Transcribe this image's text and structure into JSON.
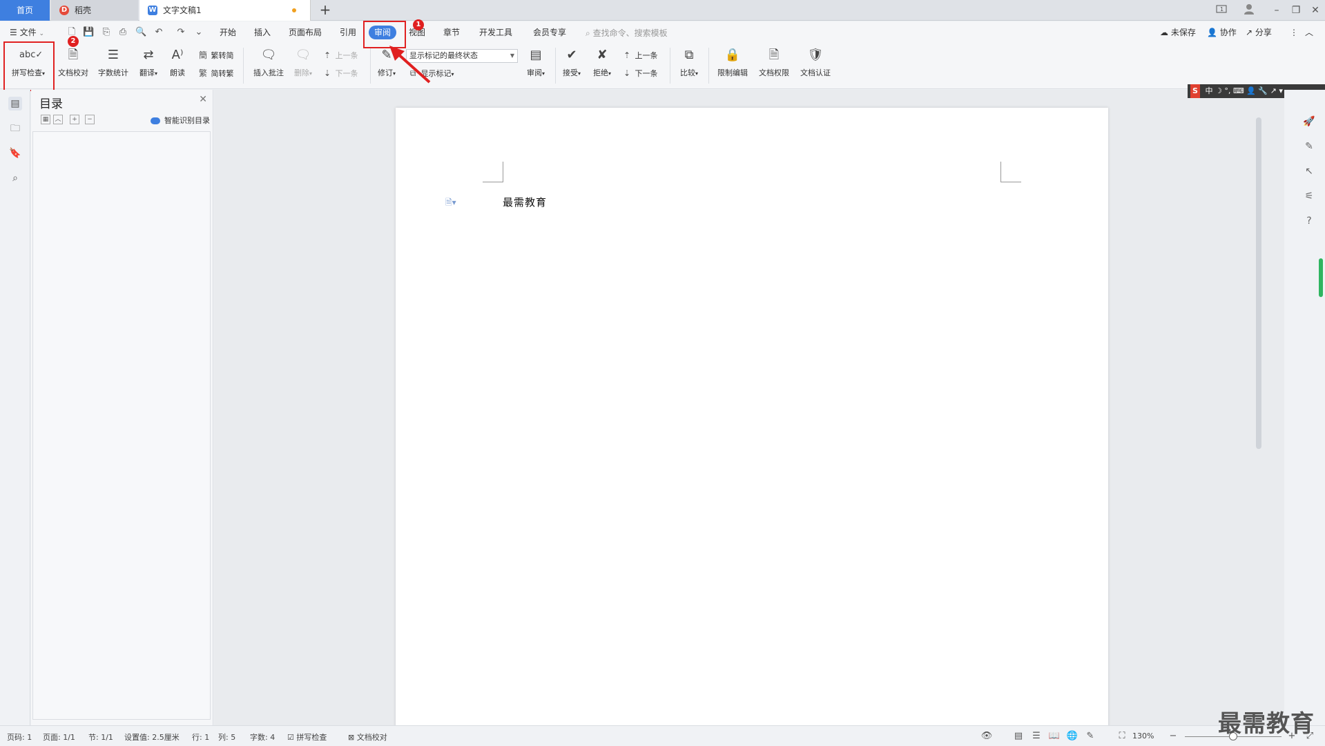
{
  "tabs": {
    "home": "首页",
    "daoke": "稻壳",
    "doc": "文字文稿1",
    "new_tab": "+"
  },
  "window_controls": [
    "1",
    "–",
    "❐",
    "✕"
  ],
  "menu": {
    "file": "文件",
    "items": [
      "开始",
      "插入",
      "页面布局",
      "引用",
      "审阅",
      "视图",
      "章节",
      "开发工具",
      "会员专享"
    ],
    "active": "审阅",
    "search_placeholder": "查找命令、搜索模板",
    "unsaved": "未保存",
    "collab": "协作",
    "share": "分享"
  },
  "ribbon": {
    "spell_check": "拼写检查",
    "doc_proof": "文档校对",
    "word_count": "字数统计",
    "translate": "翻译",
    "read_aloud": "朗读",
    "trad_to_simp": "繁转简",
    "simp_to_trad": "简转繁",
    "insert_comment": "插入批注",
    "delete": "删除",
    "prev": "上一条",
    "next": "下一条",
    "track_changes": "修订",
    "markup_state": "显示标记的最终状态",
    "show_markup": "显示标记",
    "review": "审阅",
    "accept": "接受",
    "reject": "拒绝",
    "prev2": "上一条",
    "next2": "下一条",
    "compare": "比较",
    "restrict_edit": "限制编辑",
    "doc_rights": "文档权限",
    "doc_cert": "文档认证"
  },
  "annotations": {
    "badge1": "1",
    "badge2": "2"
  },
  "toc": {
    "title": "目录",
    "smart": "智能识别目录"
  },
  "document": {
    "text": "最需教育"
  },
  "ime": {
    "s": "S",
    "lang": "中"
  },
  "status": {
    "page_code": "页码: 1",
    "page": "页面: 1/1",
    "section": "节: 1/1",
    "setting": "设置值: 2.5厘米",
    "row": "行: 1",
    "col": "列: 5",
    "word_count": "字数: 4",
    "spell_check": "拼写检查",
    "doc_proof": "文档校对",
    "zoom": "130%"
  },
  "watermark": "最需教育",
  "colors": {
    "accent": "#3e7fe0",
    "annotation_red": "#e02020",
    "scroll_green": "#2fb560"
  }
}
